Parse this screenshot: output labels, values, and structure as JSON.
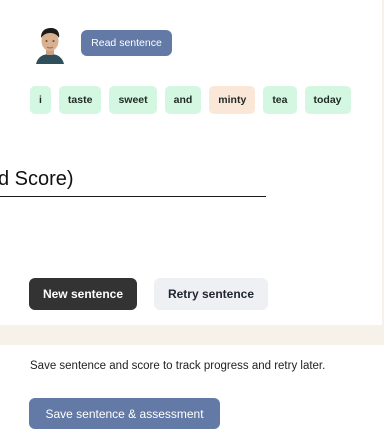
{
  "recorder": {
    "read_button_label": "Read sentence"
  },
  "sentence": {
    "words": [
      "i",
      "taste",
      "sweet",
      "and",
      "minty",
      "tea",
      "today"
    ]
  },
  "score": {
    "heading_text": "d Score)"
  },
  "actions": {
    "new_sentence_label": "New sentence",
    "retry_sentence_label": "Retry sentence"
  },
  "save": {
    "description": "Save sentence and score to track progress and retry later.",
    "button_label": "Save sentence & assessment"
  },
  "colors": {
    "accent": "#6379a6",
    "word_ok": "#d4f7e2",
    "word_warn": "#fbe7d7",
    "dark_button": "#333333"
  },
  "icons": {
    "avatar": "user-avatar-icon"
  }
}
